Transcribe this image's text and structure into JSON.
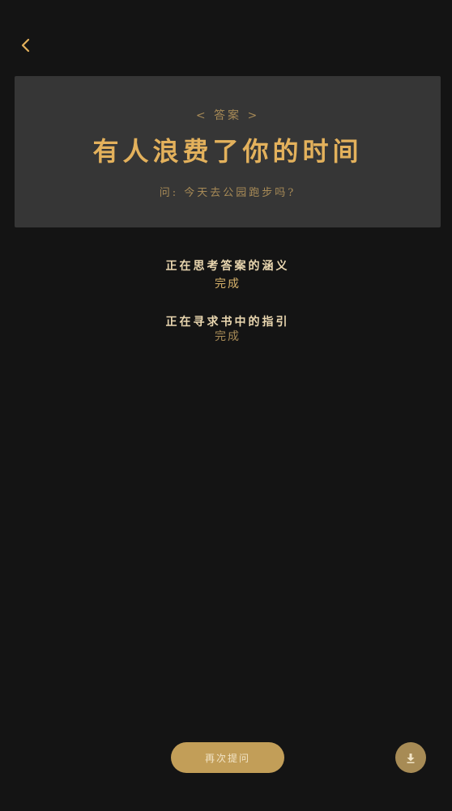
{
  "answer_card": {
    "label": "< 答案 >",
    "answer": "有人浪费了你的时间",
    "question": "问: 今天去公园跑步吗?"
  },
  "status": [
    {
      "title": "正在思考答案的涵义",
      "state": "完成"
    },
    {
      "title": "正在寻求书中的指引",
      "state": "完成"
    }
  ],
  "actions": {
    "ask_again_label": "再次提问"
  },
  "icons": {
    "back": "chevron-left-icon",
    "download": "download-icon"
  },
  "colors": {
    "background": "#141414",
    "card": "#363636",
    "gold": "#e3b15c",
    "muted_gold": "#a88b57",
    "button": "#c29e58"
  }
}
